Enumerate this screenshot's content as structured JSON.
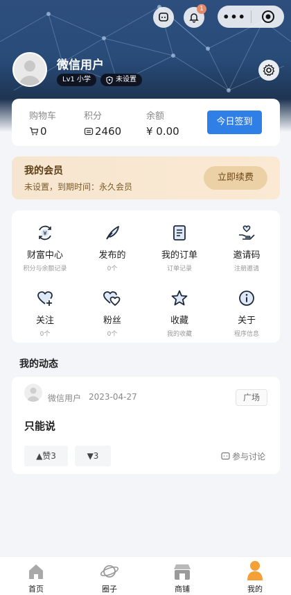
{
  "header": {
    "notification_count": "1",
    "capsule_dots": "•••",
    "username": "微信用户",
    "level_tag": "Lv1 小学",
    "verify_tag": "未设置"
  },
  "stats": {
    "cart": {
      "label": "购物车",
      "value": "0"
    },
    "points": {
      "label": "积分",
      "value": "2460"
    },
    "balance": {
      "label": "余额",
      "value": "¥ 0.00"
    },
    "signin_label": "今日签到"
  },
  "member": {
    "title": "我的会员",
    "subtitle": "未设置，到期时间：永久会员",
    "renew_label": "立即续费"
  },
  "grid": [
    {
      "title": "财富中心",
      "sub": "积分与余额记录",
      "icon": "wealth-icon"
    },
    {
      "title": "发布的",
      "sub": "0个",
      "icon": "feather-icon"
    },
    {
      "title": "我的订单",
      "sub": "订单记录",
      "icon": "order-icon"
    },
    {
      "title": "邀请码",
      "sub": "注册邀请",
      "icon": "invite-icon"
    },
    {
      "title": "关注",
      "sub": "0个",
      "icon": "heart-plus-icon"
    },
    {
      "title": "粉丝",
      "sub": "0个",
      "icon": "hearts-icon"
    },
    {
      "title": "收藏",
      "sub": "我的收藏",
      "icon": "star-icon"
    },
    {
      "title": "关于",
      "sub": "程序信息",
      "icon": "info-icon"
    }
  ],
  "feed": {
    "section_title": "我的动态",
    "post": {
      "author": "微信用户",
      "date": "2023-04-27",
      "category": "广场",
      "content": "只能说",
      "upvote": "▲赞3",
      "downvote": "▼3",
      "discuss_label": "参与讨论"
    }
  },
  "tabbar": [
    {
      "label": "首页",
      "icon": "home-icon"
    },
    {
      "label": "圈子",
      "icon": "planet-icon"
    },
    {
      "label": "商铺",
      "icon": "shop-icon"
    },
    {
      "label": "我的",
      "icon": "profile-icon"
    }
  ],
  "colors": {
    "accent": "#2f7fe6",
    "member_bg": "#f7e6cf",
    "active_tab": "#f5a036"
  }
}
